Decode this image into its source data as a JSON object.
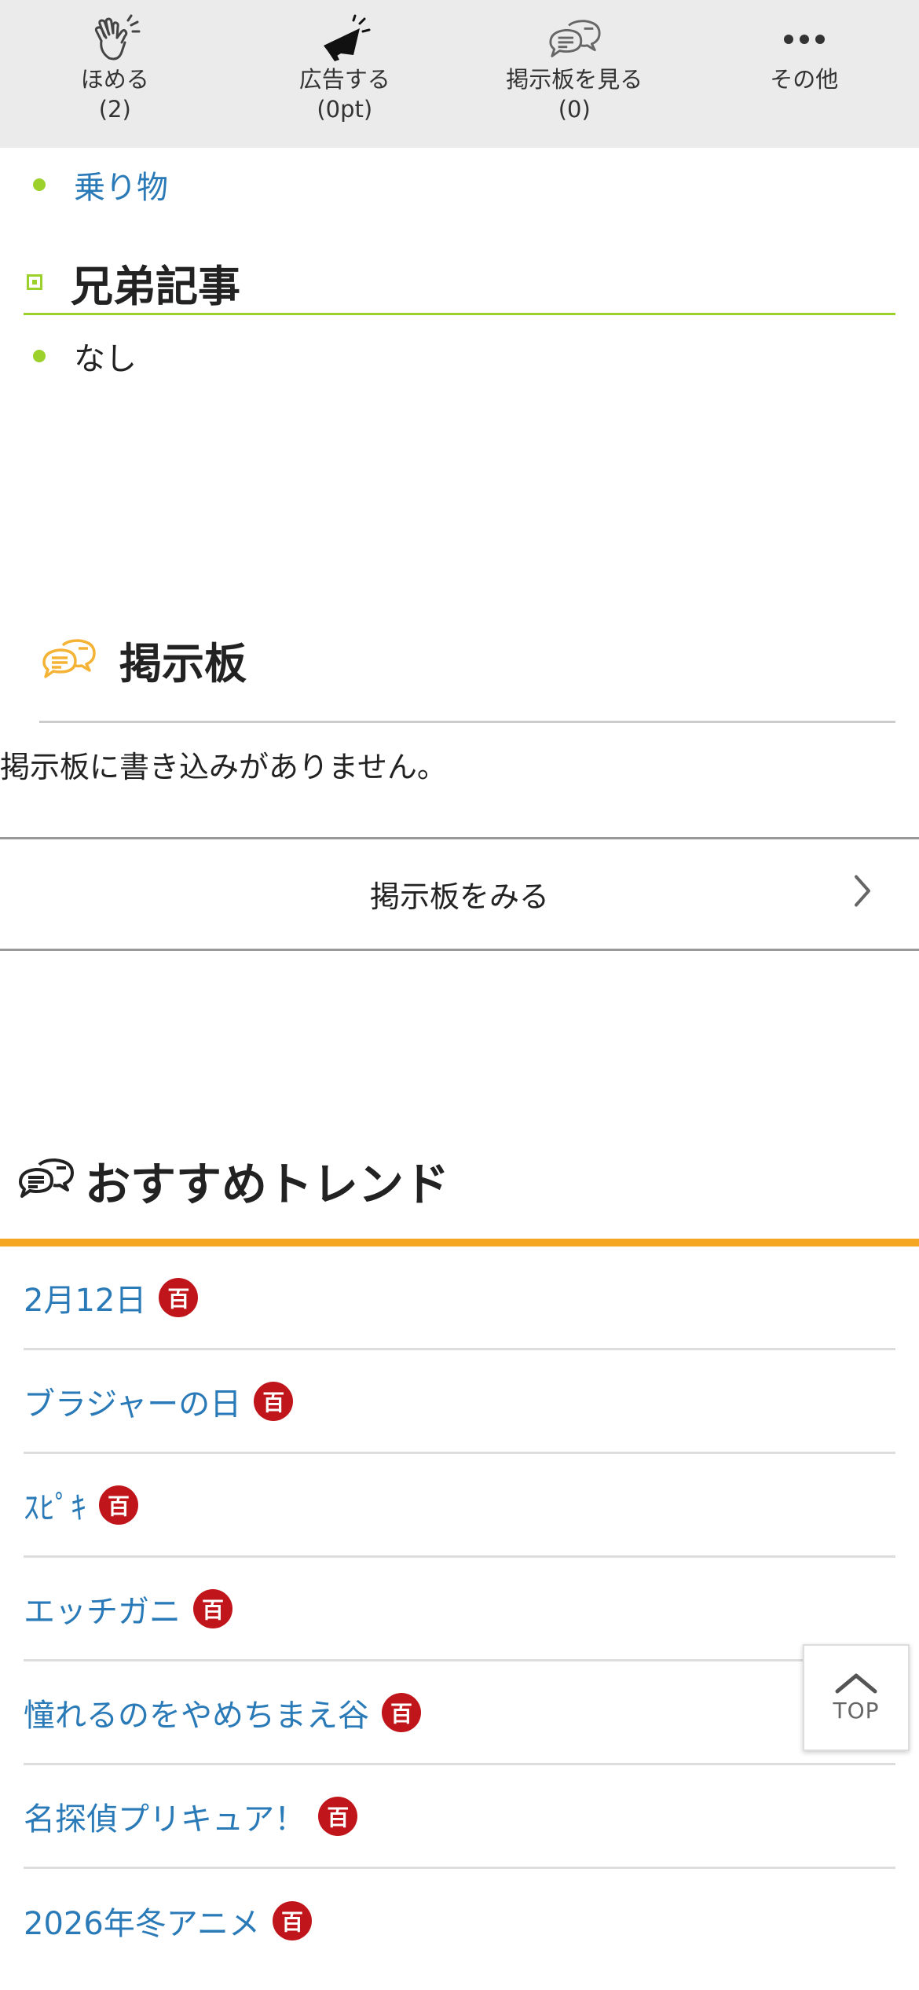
{
  "action_bar": [
    {
      "label": "ほめる",
      "count": "(2)",
      "icon": "clap-icon"
    },
    {
      "label": "広告する",
      "count": "(0pt)",
      "icon": "megaphone-icon"
    },
    {
      "label": "掲示板を見る",
      "count": "(0)",
      "icon": "chat-bubble-icon"
    },
    {
      "label": "その他",
      "count": "",
      "icon": "more-icon"
    }
  ],
  "related": {
    "parent_item": "乗り物",
    "siblings_heading": "兄弟記事",
    "siblings_item": "なし"
  },
  "board": {
    "heading": "掲示板",
    "empty_message": "掲示板に書き込みがありません。",
    "view_button": "掲示板をみる"
  },
  "trends": {
    "heading": "おすすめトレンド",
    "badge_text": "百",
    "items": [
      "2月12日",
      "ブラジャーの日",
      "ｽﾋﾟｷ",
      "エッチガニ",
      "憧れるのをやめちまえ谷",
      "名探偵プリキュア！",
      "2026年冬アニメ"
    ]
  },
  "top_button": "TOP",
  "colors": {
    "accent_green": "#9bd12a",
    "link_blue": "#2a7ab8",
    "trend_orange": "#f5a623",
    "badge_red": "#c0161b",
    "board_icon_yellow": "#f5b335"
  }
}
